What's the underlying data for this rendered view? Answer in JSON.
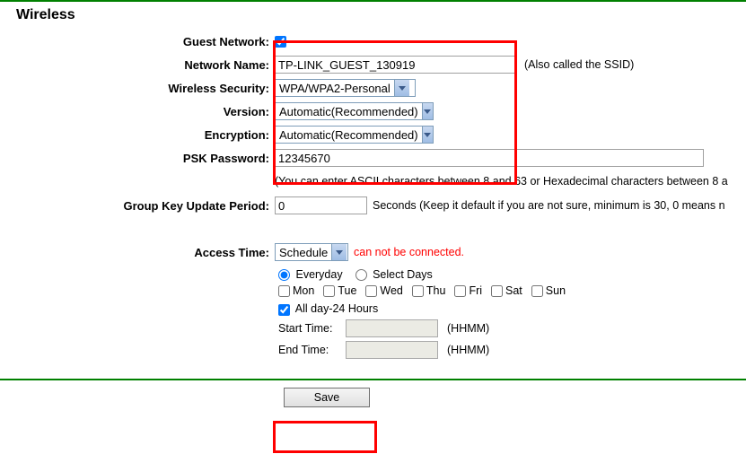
{
  "title": "Wireless",
  "labels": {
    "guest_network": "Guest Network:",
    "network_name": "Network Name:",
    "wireless_security": "Wireless Security:",
    "version": "Version:",
    "encryption": "Encryption:",
    "psk_password": "PSK Password:",
    "group_key": "Group Key Update Period:",
    "access_time": "Access Time:"
  },
  "values": {
    "network_name": "TP-LINK_GUEST_130919",
    "ssid_hint": "(Also called the SSID)",
    "security": "WPA/WPA2-Personal",
    "version": "Automatic(Recommended)",
    "encryption": "Automatic(Recommended)",
    "psk": "12345670",
    "psk_hint": "(You can enter ASCII characters between 8 and 63 or Hexadecimal characters between 8 a",
    "group_key": "0",
    "group_key_hint": "Seconds (Keep it default if you are not sure, minimum is 30, 0 means n",
    "access_mode": "Schedule",
    "error": "can not be connected."
  },
  "schedule": {
    "everyday": "Everyday",
    "select_days": "Select Days",
    "days": [
      "Mon",
      "Tue",
      "Wed",
      "Thu",
      "Fri",
      "Sat",
      "Sun"
    ],
    "allday": "All day-24 Hours",
    "start": "Start Time:",
    "end": "End Time:",
    "hhmm": "(HHMM)"
  },
  "buttons": {
    "save": "Save"
  }
}
